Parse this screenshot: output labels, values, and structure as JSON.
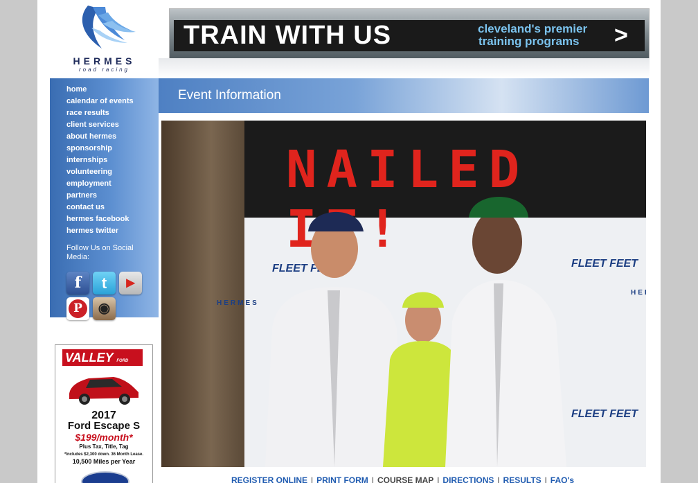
{
  "logo": {
    "name": "HERMES",
    "tagline": "road racing"
  },
  "sidebar": {
    "items": [
      {
        "label": "home"
      },
      {
        "label": "calendar of events"
      },
      {
        "label": "race results"
      },
      {
        "label": "client services"
      },
      {
        "label": "about hermes"
      },
      {
        "label": "sponsorship"
      },
      {
        "label": "internships"
      },
      {
        "label": "volunteering"
      },
      {
        "label": "employment"
      },
      {
        "label": "partners"
      },
      {
        "label": "contact us"
      },
      {
        "label": "hermes facebook"
      },
      {
        "label": "hermes twitter"
      }
    ],
    "follow_text": "Follow Us on Social Media:",
    "social": [
      {
        "name": "facebook-icon",
        "glyph": "f"
      },
      {
        "name": "twitter-icon",
        "glyph": "t"
      },
      {
        "name": "youtube-icon",
        "glyph": "▶"
      },
      {
        "name": "pinterest-icon",
        "glyph": "P"
      },
      {
        "name": "instagram-icon",
        "glyph": "◉"
      }
    ]
  },
  "ad": {
    "brand": "VALLEY",
    "brand_sub": "FORD TRUCK, INC.",
    "year": "2017",
    "model": "Ford Escape S",
    "price": "$199/month*",
    "tax": "Plus Tax, Title, Tag",
    "terms": "*Includes $2,300 down. 36 Month Lease.",
    "miles": "10,500 Miles per Year"
  },
  "banner": {
    "title": "TRAIN WITH US",
    "sub1": "cleveland's premier",
    "sub2": "training programs",
    "arrow": ">"
  },
  "page": {
    "title": "Event Information"
  },
  "photo": {
    "sign_text": "NAILED IT!",
    "watermarks": [
      "FLEET FEET",
      "HERMES"
    ]
  },
  "links": {
    "register": "REGISTER ONLINE",
    "print": "PRINT FORM",
    "course": "COURSE MAP",
    "directions": "DIRECTIONS",
    "results": "RESULTS",
    "faqs": "FAQ's",
    "separator": "|"
  },
  "colors": {
    "sidebar_blue": "#3a6db2",
    "link_blue": "#1f5bb0",
    "banner_accent": "#7bc3ee",
    "sign_red": "#e0241d"
  }
}
